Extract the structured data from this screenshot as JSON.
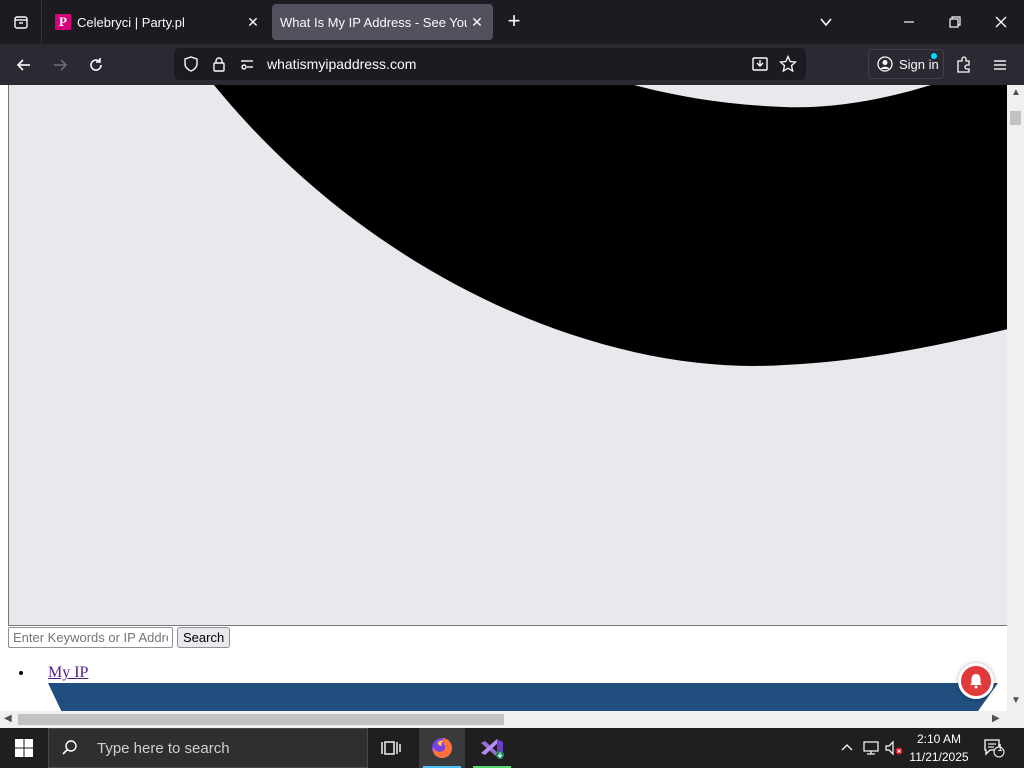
{
  "browser": {
    "tabs": [
      {
        "title": "Celebryci | Party.pl",
        "favicon": "P",
        "active": false
      },
      {
        "title": "What Is My IP Address - See Your Public Address",
        "active": true
      }
    ],
    "url": "whatismyipaddress.com",
    "sign_in_label": "Sign in"
  },
  "page": {
    "search_placeholder": "Enter Keywords or IP Address",
    "search_button": "Search",
    "menu_items": [
      "My IP"
    ]
  },
  "taskbar": {
    "search_placeholder": "Type here to search",
    "time": "2:10 AM",
    "date": "11/21/2025",
    "notification_count": "1"
  },
  "colors": {
    "banner": "#1f4e7f",
    "notif_bell": "#e03a3a",
    "firefox_underline": "#4cc2ff",
    "vs_underline": "#54d96a"
  }
}
